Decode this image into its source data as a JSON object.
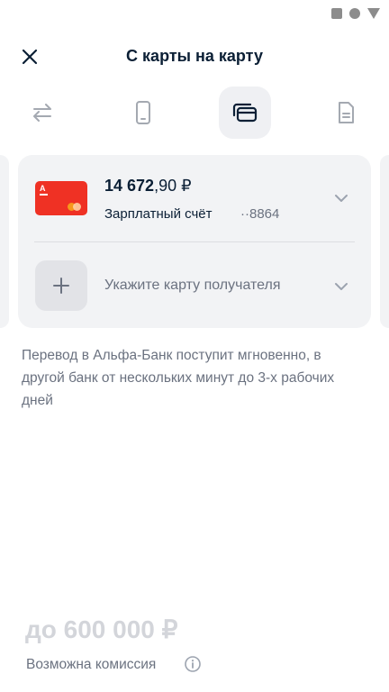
{
  "header": {
    "title": "С карты на карту",
    "close_icon": "close-icon"
  },
  "tabs": [
    {
      "icon": "transfer-arrows-icon",
      "active": false
    },
    {
      "icon": "phone-icon",
      "active": false
    },
    {
      "icon": "cards-icon",
      "active": true
    },
    {
      "icon": "document-icon",
      "active": false
    }
  ],
  "source_account": {
    "amount_int": "14 672",
    "amount_dec": ",90 ₽",
    "name": "Зарплатный счёт",
    "number": "··8864",
    "card_logo": "А",
    "card_color": "#ef3124"
  },
  "recipient": {
    "placeholder": "Укажите карту получателя"
  },
  "info_text": "Перевод в Альфа-Банк поступит мгновенно, в другой банк от нескольких минут до 3-х рабочих дней",
  "amount_input": {
    "placeholder": "до 600 000 ₽"
  },
  "commission": {
    "label": "Возможна комиссия"
  },
  "colors": {
    "accent_red": "#ef3124",
    "text_primary": "#0b1f35",
    "text_secondary": "#6b7280"
  }
}
